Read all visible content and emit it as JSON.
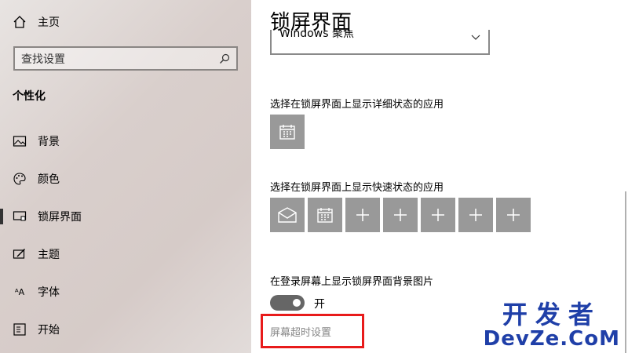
{
  "sidebar": {
    "home": "主页",
    "search_placeholder": "查找设置",
    "section": "个性化",
    "items": [
      {
        "label": "背景"
      },
      {
        "label": "颜色"
      },
      {
        "label": "锁屏界面"
      },
      {
        "label": "主题"
      },
      {
        "label": "字体"
      },
      {
        "label": "开始"
      }
    ]
  },
  "main": {
    "title": "锁屏界面",
    "dropdown_value": "Windows 聚焦",
    "detailed_status_label": "选择在锁屏界面上显示详细状态的应用",
    "quick_status_label": "选择在锁屏界面上显示快速状态的应用",
    "signin_bg_label": "在登录屏幕上显示锁屏界面背景图片",
    "toggle_state": "开",
    "screen_timeout_link": "屏幕超时设置"
  },
  "watermark": {
    "cn": "开发者",
    "en": "DevZe.CoM"
  },
  "colors": {
    "accent_red": "#e81b1b",
    "tile_gray": "#999999",
    "watermark_blue": "#1f3fa8"
  }
}
